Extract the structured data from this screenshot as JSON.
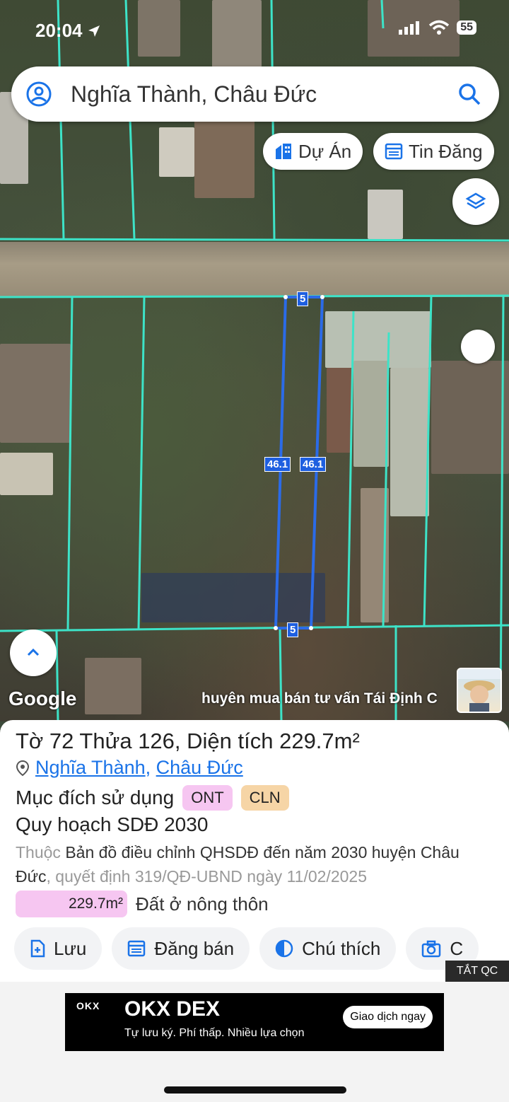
{
  "status_bar": {
    "time": "20:04",
    "battery": "55"
  },
  "search": {
    "query": "Nghĩa Thành, Châu Đức"
  },
  "chips": {
    "projects": "Dự Án",
    "listings": "Tin Đăng"
  },
  "map": {
    "google_logo": "Google",
    "plot_label_top": "5",
    "plot_label_bottom": "5",
    "plot_label_left": "46.1",
    "plot_label_right": "46.1",
    "scrolling_text": "huyên mua bán tư vấn Tái Định C"
  },
  "parcel": {
    "title": "Tờ 72 Thửa 126, Diện tích 229.7m²",
    "ward": "Nghĩa Thành",
    "separator": ", ",
    "district": "Châu Đức",
    "purpose_label": "Mục đích sử dụng",
    "purpose_tags": [
      {
        "code": "ONT",
        "color": "#f6c6f1"
      },
      {
        "code": "CLN",
        "color": "#f6d5a6"
      }
    ],
    "plan_label": "Quy hoạch SDĐ 2030",
    "desc_prefix": "Thuộc ",
    "desc_map": "Bản đồ điều chỉnh QHSDĐ đến năm 2030 huyện Châu Đức",
    "desc_decision": ", quyết định 319/QĐ-UBND ngày 11/02/2025",
    "area_value": "229.7m²",
    "area_type": "Đất ở nông thôn"
  },
  "actions": {
    "save": "Lưu",
    "post_sale": "Đăng bán",
    "legend": "Chú thích",
    "capture": "C"
  },
  "ad": {
    "close_label": "TẮT QC",
    "logo": "OKX",
    "title": "OKX DEX",
    "subtitle": "Tự lưu ký. Phí thấp. Nhiều lựa chọn",
    "cta": "Giao dịch ngay"
  },
  "colors": {
    "parcel_line": "#3de3c8",
    "selected_parcel": "#2b6be8",
    "accent": "#1a73e8",
    "ont_badge": "#f6c6f1",
    "cln_badge": "#f6d5a6"
  }
}
